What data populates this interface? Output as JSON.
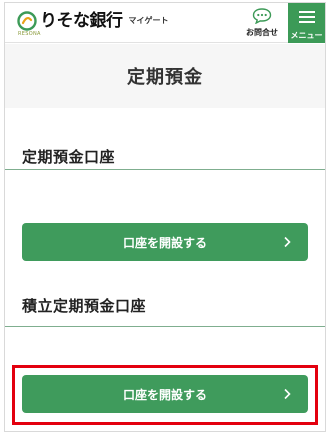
{
  "header": {
    "logo_text": "りそな銀行",
    "logo_sub": "マイゲート",
    "logo_tag": "RESONA",
    "inquiry_label": "お問合せ",
    "menu_label": "メニュー"
  },
  "page": {
    "title": "定期預金"
  },
  "sections": [
    {
      "heading": "定期預金口座",
      "button_label": "口座を開設する"
    },
    {
      "heading": "積立定期預金口座",
      "button_label": "口座を開設する"
    }
  ],
  "colors": {
    "brand_green": "#3f9b5c",
    "highlight_red": "#e3000f"
  }
}
